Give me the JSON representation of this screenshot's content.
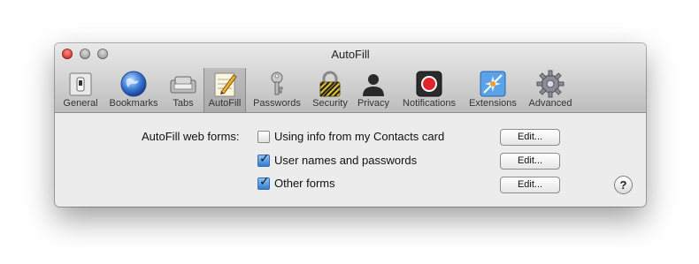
{
  "window": {
    "title": "AutoFill"
  },
  "toolbar": {
    "items": [
      {
        "label": "General"
      },
      {
        "label": "Bookmarks"
      },
      {
        "label": "Tabs"
      },
      {
        "label": "AutoFill",
        "selected": true
      },
      {
        "label": "Passwords"
      },
      {
        "label": "Security"
      },
      {
        "label": "Privacy"
      },
      {
        "label": "Notifications"
      },
      {
        "label": "Extensions"
      },
      {
        "label": "Advanced"
      }
    ]
  },
  "autofill": {
    "section_label": "AutoFill web forms:",
    "options": [
      {
        "label": "Using info from my Contacts card",
        "checked": false,
        "button": "Edit..."
      },
      {
        "label": "User names and passwords",
        "checked": true,
        "button": "Edit..."
      },
      {
        "label": "Other forms",
        "checked": true,
        "button": "Edit..."
      }
    ],
    "help": "?"
  },
  "colors": {
    "close": "#de3f38",
    "checkbox_checked": "#2f7fd3",
    "notifications_red": "#e0262b"
  }
}
